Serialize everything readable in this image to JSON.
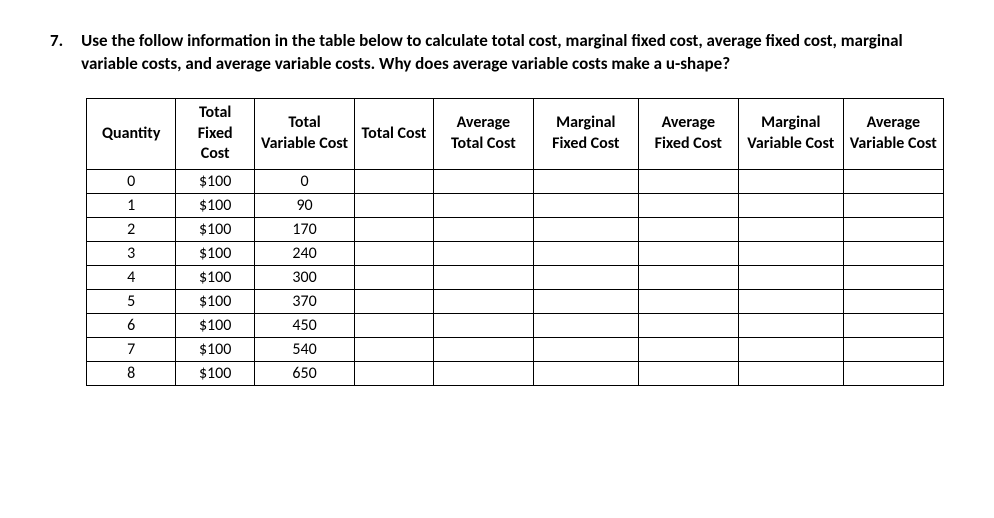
{
  "question": {
    "number": "7.",
    "text": "Use the follow information in the table below to calculate total cost, marginal fixed cost, average fixed cost, marginal variable costs, and average variable costs. Why does average variable costs make a u-shape?"
  },
  "table": {
    "headers": {
      "qty": "Quantity",
      "tfc": "Total Fixed Cost",
      "tvc": "Total Variable Cost",
      "tc": "Total Cost",
      "atc": "Average Total Cost",
      "mfc": "Marginal Fixed Cost",
      "afc": "Average Fixed Cost",
      "mvc": "Marginal Variable Cost",
      "avc": "Average Variable Cost"
    },
    "rows": [
      {
        "qty": "0",
        "tfc": "$100",
        "tvc": "0",
        "tc": "",
        "atc": "",
        "mfc": "",
        "afc": "",
        "mvc": "",
        "avc": ""
      },
      {
        "qty": "1",
        "tfc": "$100",
        "tvc": "90",
        "tc": "",
        "atc": "",
        "mfc": "",
        "afc": "",
        "mvc": "",
        "avc": ""
      },
      {
        "qty": "2",
        "tfc": "$100",
        "tvc": "170",
        "tc": "",
        "atc": "",
        "mfc": "",
        "afc": "",
        "mvc": "",
        "avc": ""
      },
      {
        "qty": "3",
        "tfc": "$100",
        "tvc": "240",
        "tc": "",
        "atc": "",
        "mfc": "",
        "afc": "",
        "mvc": "",
        "avc": ""
      },
      {
        "qty": "4",
        "tfc": "$100",
        "tvc": "300",
        "tc": "",
        "atc": "",
        "mfc": "",
        "afc": "",
        "mvc": "",
        "avc": ""
      },
      {
        "qty": "5",
        "tfc": "$100",
        "tvc": "370",
        "tc": "",
        "atc": "",
        "mfc": "",
        "afc": "",
        "mvc": "",
        "avc": ""
      },
      {
        "qty": "6",
        "tfc": "$100",
        "tvc": "450",
        "tc": "",
        "atc": "",
        "mfc": "",
        "afc": "",
        "mvc": "",
        "avc": ""
      },
      {
        "qty": "7",
        "tfc": "$100",
        "tvc": "540",
        "tc": "",
        "atc": "",
        "mfc": "",
        "afc": "",
        "mvc": "",
        "avc": ""
      },
      {
        "qty": "8",
        "tfc": "$100",
        "tvc": "650",
        "tc": "",
        "atc": "",
        "mfc": "",
        "afc": "",
        "mvc": "",
        "avc": ""
      }
    ]
  }
}
